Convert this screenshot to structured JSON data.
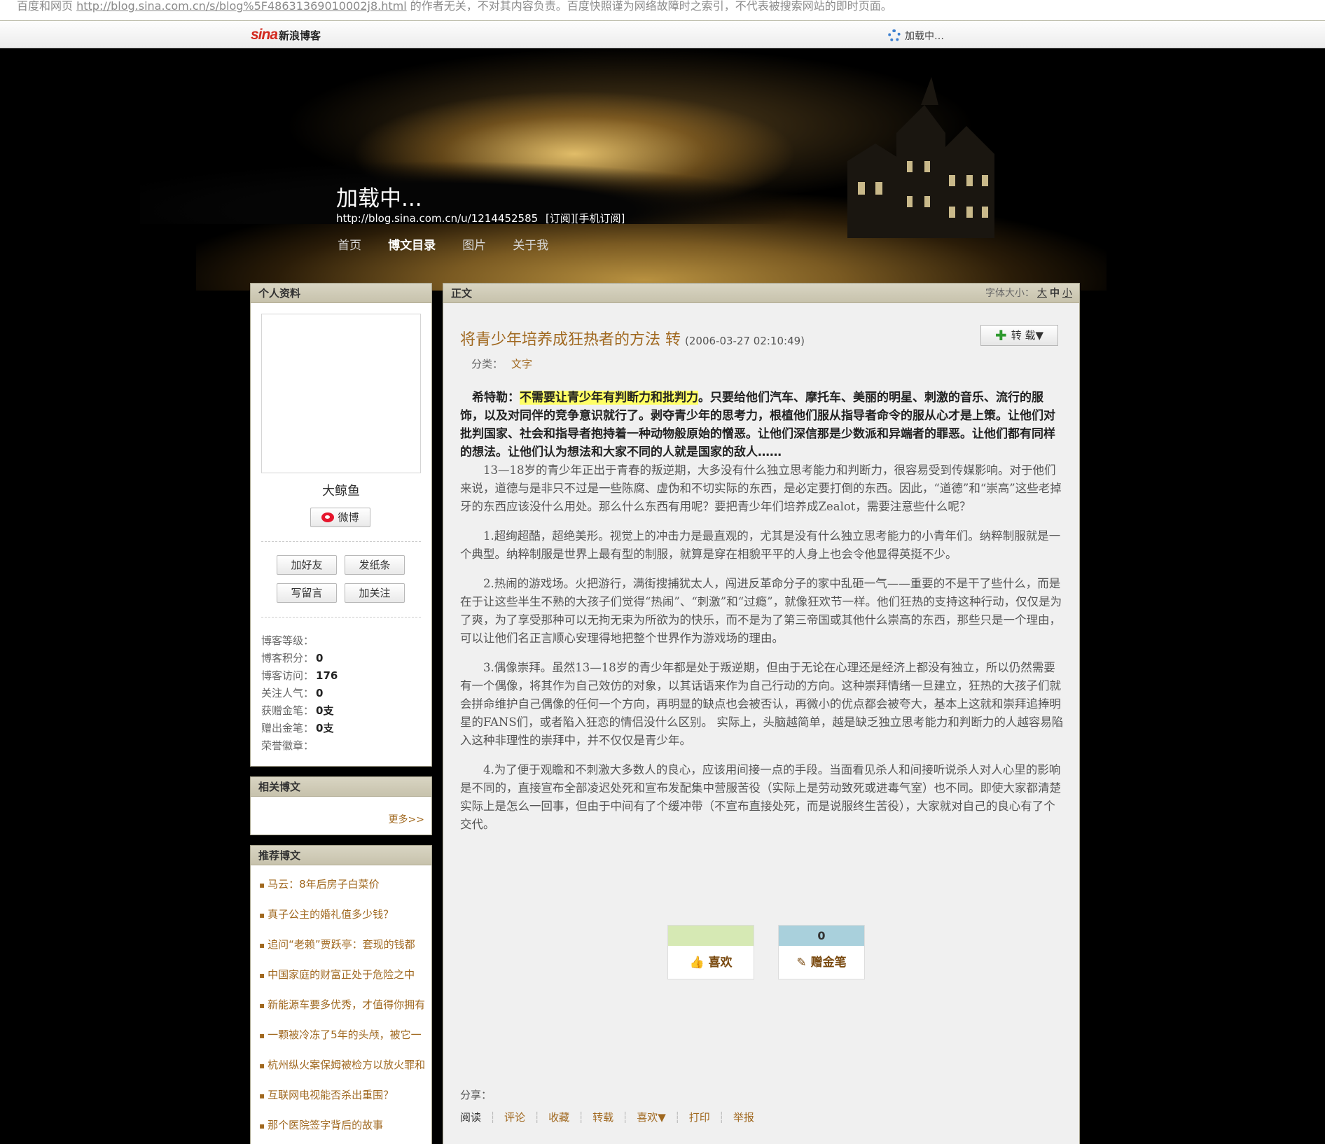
{
  "cache_notice": {
    "prefix": "百度和网页 ",
    "url": "http://blog.sina.com.cn/s/blog%5F48631369010002j8.html",
    "suffix": " 的作者无关，不对其内容负责。百度快照谨为网络故障时之索引，不代表被搜索网站的即时页面。"
  },
  "topbar": {
    "logo_mark": "sina",
    "logo_text": "新浪博客",
    "loading": "加载中…"
  },
  "header": {
    "title": "加载中...",
    "url": "http://blog.sina.com.cn/u/1214452585",
    "subscribe": "[订阅]",
    "mobile_subscribe": "[手机订阅]",
    "nav": [
      "首页",
      "博文目录",
      "图片",
      "关于我"
    ]
  },
  "profile": {
    "heading": "个人资料",
    "nickname": "大鲸鱼",
    "weibo_label": "微博",
    "buttons": [
      "加好友",
      "发纸条",
      "写留言",
      "加关注"
    ],
    "stats": [
      {
        "label": "博客等级：",
        "value": ""
      },
      {
        "label": "博客积分：",
        "value": "0"
      },
      {
        "label": "博客访问：",
        "value": "176"
      },
      {
        "label": "关注人气：",
        "value": "0"
      },
      {
        "label": "获赠金笔：",
        "value": "0支"
      },
      {
        "label": "赠出金笔：",
        "value": "0支"
      },
      {
        "label": "荣誉徽章：",
        "value": ""
      }
    ]
  },
  "related": {
    "heading": "相关博文",
    "more": "更多>>"
  },
  "recommend": {
    "heading": "推荐博文",
    "items": [
      "马云：8年后房子白菜价",
      "真子公主的婚礼值多少钱？",
      "追问“老赖”贾跃亭：套现的钱都",
      "中国家庭的财富正处于危险之中",
      "新能源车要多优秀，才值得你拥有",
      "一颗被冷冻了5年的头颅，被它一",
      "杭州纵火案保姆被检方以放火罪和",
      "互联网电视能否杀出重围？",
      "那个医院签字背后的故事"
    ]
  },
  "article": {
    "heading": "正文",
    "font_size_label": "字体大小：",
    "font_sizes": [
      "大",
      "中",
      "小"
    ],
    "title": "将青少年培养成狂热者的方法 转",
    "time": "(2006-03-27 02:10:49)",
    "repost_label": "转 载▼",
    "category_label": "分类：",
    "category": "文字",
    "lead_prefix": "希特勒：",
    "lead_highlight": "不需要让青少年有判断力和批判力",
    "lead_rest": "。只要给他们汽车、摩托车、美丽的明星、刺激的音乐、流行的服饰，以及对同伴的竞争意识就行了。剥夺青少年的思考力，根植他们服从指导者命令的服从心才是上策。让他们对批判国家、社会和指导者抱持着一种动物般原始的憎恶。让他们深信那是少数派和异端者的罪恶。让他们都有同样的想法。让他们认为想法和大家不同的人就是国家的敌人……",
    "paragraphs": [
      "13—18岁的青少年正出于青春的叛逆期，大多没有什么独立思考能力和判断力，很容易受到传媒影响。对于他们来说，道德与是非只不过是一些陈腐、虚伪和不切实际的东西，是必定要打倒的东西。因此，“道德”和“崇高”这些老掉牙的东西应该没什么用处。那么什么东西有用呢？要把青少年们培养成Zealot，需要注意些什么呢？",
      "1.超绚超酷，超绝美形。视觉上的冲击力是最直观的，尤其是没有什么独立思考能力的小青年们。纳粹制服就是一个典型。纳粹制服是世界上最有型的制服，就算是穿在相貌平平的人身上也会令他显得英挺不少。",
      "2.热闹的游戏场。火把游行，满街搜捕犹太人，闯进反革命分子的家中乱砸一气——重要的不是干了些什么，而是在于让这些半生不熟的大孩子们觉得“热闹”、“刺激”和“过瘾”，就像狂欢节一样。他们狂热的支持这种行动，仅仅是为了爽，为了享受那种可以无拘无束为所欲为的快乐，而不是为了第三帝国或其他什么崇高的东西，那些只是一个理由，可以让他们名正言顺心安理得地把整个世界作为游戏场的理由。",
      "3.偶像崇拜。虽然13—18岁的青少年都是处于叛逆期，但由于无论在心理还是经济上都没有独立，所以仍然需要有一个偶像，将其作为自己效仿的对象，以其话语来作为自己行动的方向。这种崇拜情绪一旦建立，狂热的大孩子们就会拼命维护自己偶像的任何一个方向，再明显的缺点也会被否认，再微小的优点都会被夸大，基本上这就和崇拜追捧明星的FANS们，或者陷入狂恋的情侣没什么区别。 实际上，头脑越简单，越是缺乏独立思考能力和判断力的人越容易陷入这种非理性的崇拜中，并不仅仅是青少年。",
      "4.为了便于观瞻和不刺激大多数人的良心，应该用间接一点的手段。当面看见杀人和间接听说杀人对人心里的影响是不同的，直接宣布全部凌迟处死和宣布发配集中营服苦役（实际上是劳动致死或进毒气室）也不同。即使大家都清楚实际上是怎么一回事，但由于中间有了个缓冲带（不宣布直接处死，而是说服终生苦役），大家就对自己的良心有了个交代。"
    ],
    "like": {
      "count": "",
      "label": "喜欢",
      "color": "#d6e9b4"
    },
    "gift": {
      "count": "0",
      "label": "赠金笔",
      "color": "#a9d0dc"
    },
    "share_label": "分享：",
    "footer_links": [
      "阅读",
      "评论",
      "收藏",
      "转载",
      "喜欢▼",
      "打印",
      "举报"
    ]
  },
  "colors": {
    "accent": "#a0681f",
    "highlight": "#ffff66"
  }
}
